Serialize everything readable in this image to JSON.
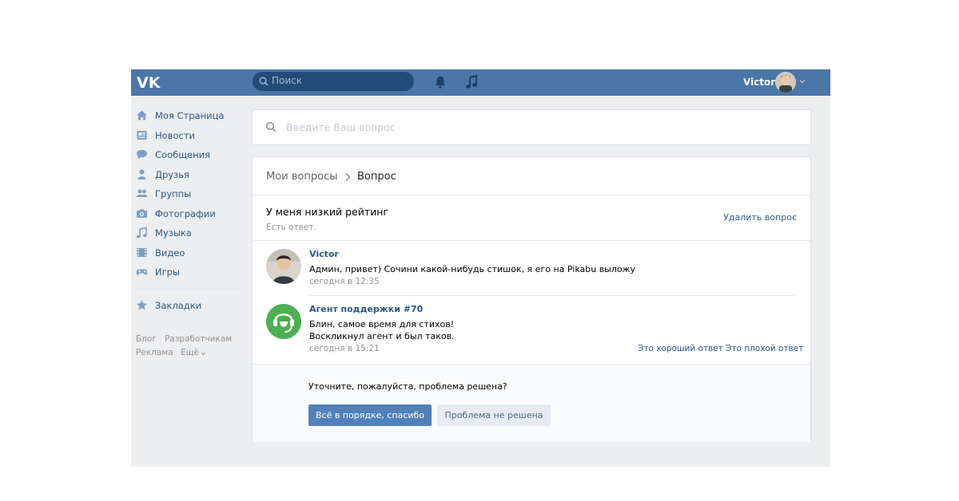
{
  "header": {
    "search_placeholder": "Поиск",
    "user_name": "Victor"
  },
  "sidebar": {
    "items": [
      {
        "label": "Моя Страница",
        "icon": "home-icon"
      },
      {
        "label": "Новости",
        "icon": "news-icon"
      },
      {
        "label": "Сообщения",
        "icon": "messages-icon"
      },
      {
        "label": "Друзья",
        "icon": "friends-icon"
      },
      {
        "label": "Группы",
        "icon": "groups-icon"
      },
      {
        "label": "Фотографии",
        "icon": "photos-icon"
      },
      {
        "label": "Музыка",
        "icon": "music-icon"
      },
      {
        "label": "Видео",
        "icon": "video-icon"
      },
      {
        "label": "Игры",
        "icon": "games-icon"
      }
    ],
    "bookmarks": {
      "label": "Закладки",
      "icon": "star-icon"
    },
    "footer_links": [
      "Блог",
      "Разработчикам",
      "Реклама",
      "Ещё"
    ]
  },
  "question_search": {
    "placeholder": "Введите Ваш вопрос"
  },
  "breadcrumb": {
    "parent": "Мои вопросы",
    "current": "Вопрос"
  },
  "question": {
    "title": "У меня низкий рейтинг",
    "status": "Есть ответ.",
    "delete_label": "Удалить вопрос"
  },
  "messages": [
    {
      "author": "Victor",
      "text_lines": [
        "Админ, привет) Сочини какой-нибудь стишок, я его на Pikabu выложу"
      ],
      "time": "сегодня в 12:35"
    },
    {
      "author": "Агент поддержки #70",
      "text_lines": [
        "Блин, самое время для стихов!",
        "Воскликнул агент и был таков."
      ],
      "time": "сегодня в 15:21",
      "rate_good": "Это хороший ответ",
      "rate_separator": "·",
      "rate_bad": "Это плохой ответ"
    }
  ],
  "resolution": {
    "prompt": "Уточните, пожалуйста, проблема решена?",
    "ok_label": "Всё в порядке, спасибо",
    "not_solved_label": "Проблема не решена"
  },
  "colors": {
    "header_bg": "#4a76a8",
    "link": "#2a5885",
    "primary_button": "#5181b8",
    "page_bg": "#edeef0"
  }
}
